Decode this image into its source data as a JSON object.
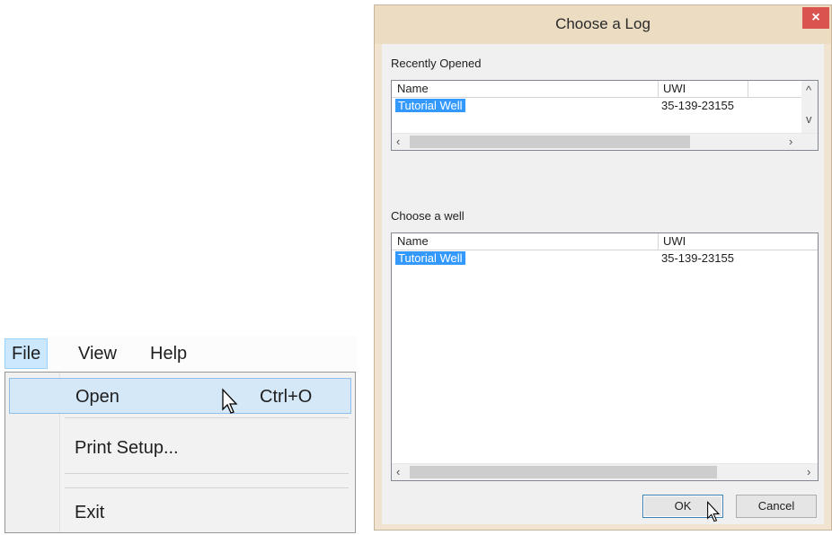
{
  "menu": {
    "bar": [
      "File",
      "View",
      "Help"
    ],
    "open": {
      "label": "Open",
      "shortcut": "Ctrl+O"
    },
    "print_setup": "Print Setup...",
    "exit": "Exit"
  },
  "dialog": {
    "title": "Choose a Log",
    "close": "×",
    "recent": {
      "label": "Recently Opened",
      "columns": [
        "Name",
        "UWI"
      ],
      "rows": [
        {
          "name": "Tutorial Well",
          "uwi": "35-139-23155"
        }
      ]
    },
    "choose": {
      "label": "Choose a well",
      "columns": [
        "Name",
        "UWI"
      ],
      "rows": [
        {
          "name": "Tutorial Well",
          "uwi": "35-139-23155"
        }
      ]
    },
    "ok": "OK",
    "cancel": "Cancel"
  },
  "icons": {
    "scroll_left": "‹",
    "scroll_right": "›",
    "scroll_up": "^",
    "scroll_down": "v",
    "cursor": "mouse-pointer-icon"
  },
  "colors": {
    "selection": "#3399ff",
    "menu_hover": "#d5e8f8",
    "dialog_frame": "#f0e3cf",
    "close": "#d9534f"
  }
}
